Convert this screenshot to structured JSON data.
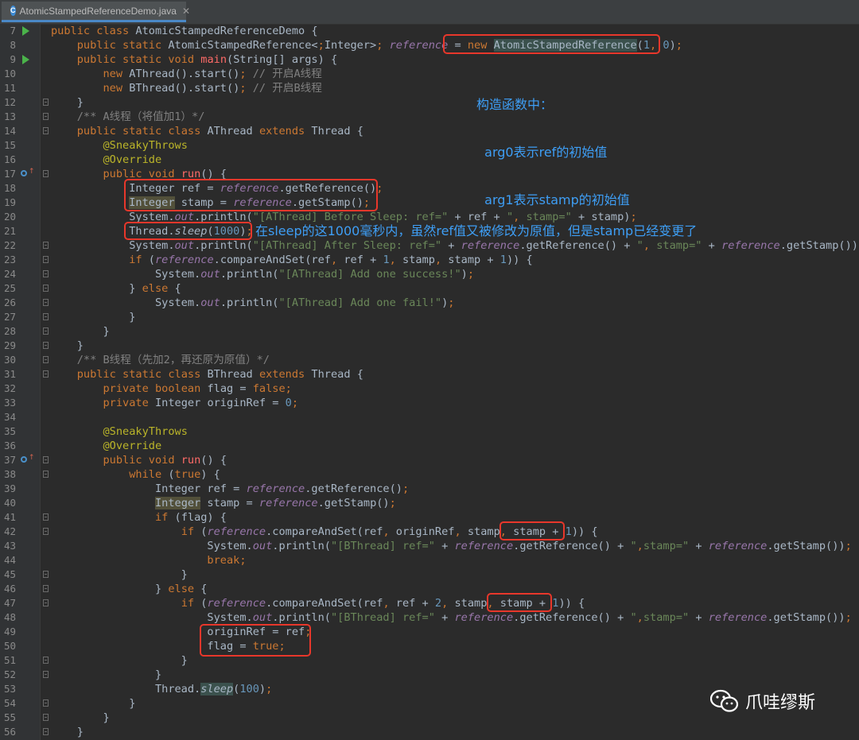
{
  "tab": {
    "title": "AtomicStampedReferenceDemo.java",
    "icon": "java-class-icon"
  },
  "annotations": {
    "constructor_note": [
      "构造函数中：",
      "  arg0表示ref的初始值",
      "  arg1表示stamp的初始值"
    ],
    "sleep_note": "在sleep的这1000毫秒内，虽然ref值又被修改为原值，但是stamp已经变更了"
  },
  "watermark": {
    "text": "爪哇缪斯",
    "icon": "wechat-icon"
  },
  "code_lines": [
    {
      "n": "7",
      "text": "public class AtomicStampedReferenceDemo {"
    },
    {
      "n": "8",
      "text": "    public static AtomicStampedReference<Integer> reference = new AtomicStampedReference(1, 0);"
    },
    {
      "n": "9",
      "text": "    public static void main(String[] args) {"
    },
    {
      "n": "10",
      "text": "        new AThread().start(); // 开启A线程"
    },
    {
      "n": "11",
      "text": "        new BThread().start(); // 开启B线程"
    },
    {
      "n": "12",
      "text": "    }"
    },
    {
      "n": "13",
      "text": "    /** A线程（将值加1）*/"
    },
    {
      "n": "14",
      "text": "    public static class AThread extends Thread {"
    },
    {
      "n": "15",
      "text": "        @SneakyThrows"
    },
    {
      "n": "16",
      "text": "        @Override"
    },
    {
      "n": "17",
      "text": "        public void run() {"
    },
    {
      "n": "18",
      "text": "            Integer ref = reference.getReference();"
    },
    {
      "n": "19",
      "text": "            Integer stamp = reference.getStamp();"
    },
    {
      "n": "20",
      "text": "            System.out.println(\"[AThread] Before Sleep: ref=\" + ref + \", stamp=\" + stamp);"
    },
    {
      "n": "21",
      "text": "            Thread.sleep(1000);"
    },
    {
      "n": "22",
      "text": "            System.out.println(\"[AThread] After Sleep: ref=\" + reference.getReference() + \", stamp=\" + reference.getStamp());"
    },
    {
      "n": "23",
      "text": "            if (reference.compareAndSet(ref, ref + 1, stamp, stamp + 1)) {"
    },
    {
      "n": "24",
      "text": "                System.out.println(\"[AThread] Add one success!\");"
    },
    {
      "n": "25",
      "text": "            } else {"
    },
    {
      "n": "26",
      "text": "                System.out.println(\"[AThread] Add one fail!\");"
    },
    {
      "n": "27",
      "text": "            }"
    },
    {
      "n": "28",
      "text": "        }"
    },
    {
      "n": "29",
      "text": "    }"
    },
    {
      "n": "30",
      "text": "    /** B线程（先加2，再还原为原值）*/"
    },
    {
      "n": "31",
      "text": "    public static class BThread extends Thread {"
    },
    {
      "n": "32",
      "text": "        private boolean flag = false;"
    },
    {
      "n": "33",
      "text": "        private Integer originRef = 0;"
    },
    {
      "n": "34",
      "text": ""
    },
    {
      "n": "35",
      "text": "        @SneakyThrows"
    },
    {
      "n": "36",
      "text": "        @Override"
    },
    {
      "n": "37",
      "text": "        public void run() {"
    },
    {
      "n": "38",
      "text": "            while (true) {"
    },
    {
      "n": "39",
      "text": "                Integer ref = reference.getReference();"
    },
    {
      "n": "40",
      "text": "                Integer stamp = reference.getStamp();"
    },
    {
      "n": "41",
      "text": "                if (flag) {"
    },
    {
      "n": "42",
      "text": "                    if (reference.compareAndSet(ref, originRef, stamp, stamp + 1)) {"
    },
    {
      "n": "43",
      "text": "                        System.out.println(\"[BThread] ref=\" + reference.getReference() + \",stamp=\" + reference.getStamp());"
    },
    {
      "n": "44",
      "text": "                        break;"
    },
    {
      "n": "45",
      "text": "                    }"
    },
    {
      "n": "46",
      "text": "                } else {"
    },
    {
      "n": "47",
      "text": "                    if (reference.compareAndSet(ref, ref + 2, stamp, stamp + 1)) {"
    },
    {
      "n": "48",
      "text": "                        System.out.println(\"[BThread] ref=\" + reference.getReference() + \",stamp=\" + reference.getStamp());"
    },
    {
      "n": "49",
      "text": "                        originRef = ref;"
    },
    {
      "n": "50",
      "text": "                        flag = true;"
    },
    {
      "n": "51",
      "text": "                    }"
    },
    {
      "n": "52",
      "text": "                }"
    },
    {
      "n": "53",
      "text": "                Thread.sleep(100);"
    },
    {
      "n": "54",
      "text": "            }"
    },
    {
      "n": "55",
      "text": "        }"
    },
    {
      "n": "56",
      "text": "    }"
    }
  ]
}
